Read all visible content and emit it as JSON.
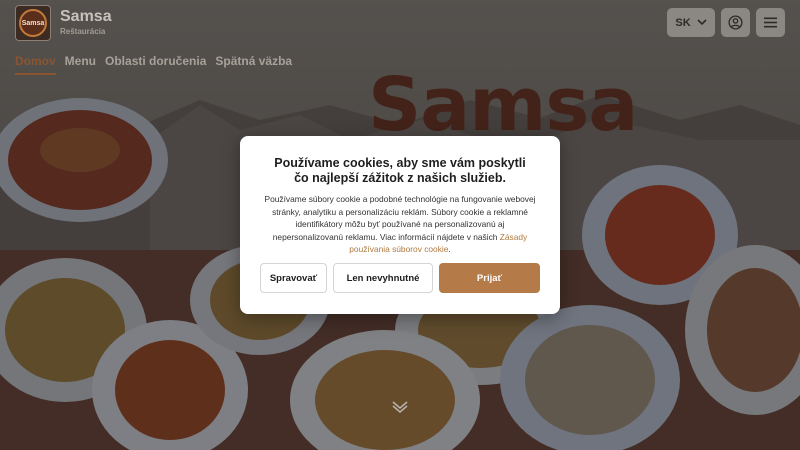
{
  "brand": {
    "name": "Samsa",
    "subtitle": "Reštaurácia",
    "logo_text": "Samsa",
    "hero_title": "Samsa"
  },
  "nav": {
    "items": [
      {
        "label": "Domov",
        "active": true
      },
      {
        "label": "Menu",
        "active": false
      },
      {
        "label": "Oblasti doručenia",
        "active": false
      },
      {
        "label": "Spätná väzba",
        "active": false
      }
    ]
  },
  "header": {
    "language": "SK",
    "icons": [
      "chevron-down-icon",
      "account-icon",
      "hamburger-menu-icon"
    ]
  },
  "cookie_modal": {
    "title": "Používame cookies, aby sme vám poskytli čo najlepší zážitok z našich služieb.",
    "body": "Používame súbory cookie a podobné technológie na fungovanie webovej stránky, analytiku a personalizáciu reklám. Súbory cookie a reklamné identifikátory môžu byť používané na personalizovanú aj nepersonalizovanú reklamu. Viac informácií nájdete v našich ",
    "link_text": "Zásady používania súborov cookie",
    "body_end": ".",
    "buttons": {
      "manage": "Spravovať",
      "necessary": "Len nevyhnutné",
      "accept": "Prijať"
    }
  },
  "colors": {
    "accent": "#b47a48",
    "hero_brand": "#5a2112",
    "nav_active": "#8a5632"
  },
  "scroll_hint_icon": "chevron-down-icon"
}
